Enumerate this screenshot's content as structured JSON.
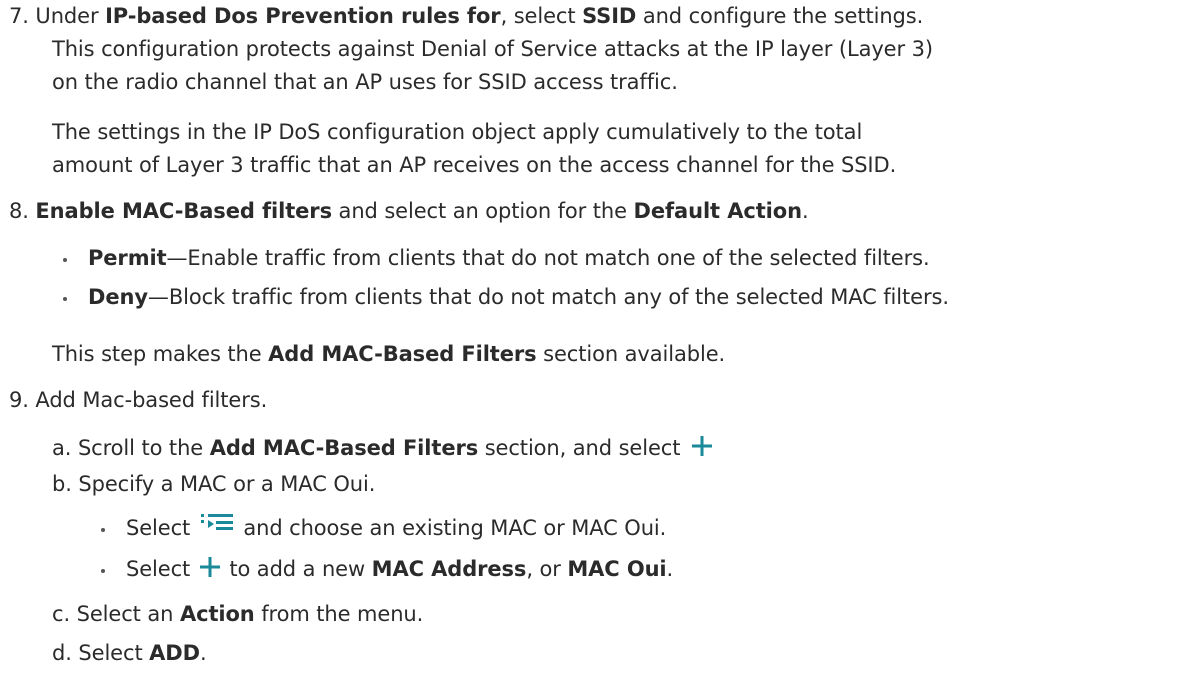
{
  "steps": {
    "s7": {
      "num": "7.",
      "l1_a": "Under ",
      "l1_b": "IP-based Dos Prevention rules for",
      "l1_c": ", select ",
      "l1_d": "SSID",
      "l1_e": " and configure the settings.",
      "l2": "This configuration protects against Denial of Service attacks at the IP layer (Layer 3)",
      "l3": "on the radio channel that an AP uses for SSID access traffic.",
      "p2_l1": "The settings in the IP DoS configuration object apply cumulatively to the total",
      "p2_l2": "amount of Layer 3 traffic that an AP receives on the access channel for the SSID."
    },
    "s8": {
      "num": "8.",
      "a": "Enable MAC-Based filters",
      "b": " and select an option for the ",
      "c": "Default Action",
      "d": ".",
      "permit_label": "Permit",
      "permit_text": "—Enable traffic from clients that do not match one of the selected filters.",
      "deny_label": "Deny",
      "deny_text": "—Block traffic from clients that do not match any of the selected MAC filters.",
      "note_a": "This step makes the ",
      "note_b": "Add MAC-Based Filters",
      "note_c": " section available."
    },
    "s9": {
      "num": "9.",
      "text": "Add Mac-based filters.",
      "a_num": "a.",
      "a_1": "Scroll to the ",
      "a_2": "Add MAC-Based Filters",
      "a_3": " section, and select",
      "b_num": "b.",
      "b_text": "Specify a MAC or a MAC Oui.",
      "b1_1": "Select",
      "b1_2": "and choose an existing MAC or MAC Oui.",
      "b2_1": "Select",
      "b2_2": "to add a new ",
      "b2_3": "MAC Address",
      "b2_4": ", or ",
      "b2_5": "MAC Oui",
      "b2_6": ".",
      "c_num": "c.",
      "c_1": "Select an ",
      "c_2": "Action",
      "c_3": " from the menu.",
      "d_num": "d.",
      "d_1": "Select ",
      "d_2": "ADD",
      "d_3": "."
    }
  },
  "icons": {
    "plus": "plus-icon",
    "list_select": "list-select-icon"
  },
  "colors": {
    "icon_teal": "#1a8a9a",
    "text": "#2b2b2b"
  }
}
